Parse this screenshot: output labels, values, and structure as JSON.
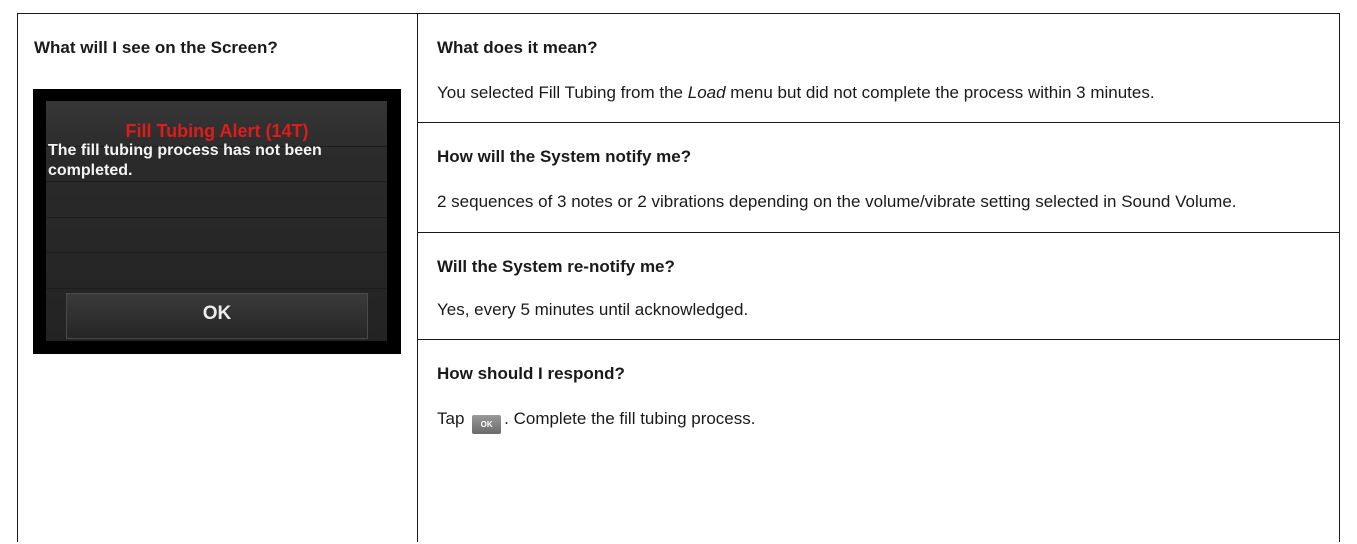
{
  "left": {
    "header": "What will I see on the Screen?",
    "screen": {
      "alert_title": "Fill Tubing Alert (14T)",
      "message": "The fill tubing process has not been completed.",
      "ok_label": "OK"
    }
  },
  "sections": [
    {
      "heading": "What does it mean?",
      "body_parts": [
        "You selected ",
        "Fill Tubing",
        " from the ",
        "Load",
        " menu but did not complete the process within 3 minutes."
      ]
    },
    {
      "heading": "How will the System notify me?",
      "body": "2 sequences of 3 notes or 2 vibrations depending on the volume/vibrate setting selected in Sound Volume."
    },
    {
      "heading": "Will the System re-notify me?",
      "body": "Yes, every 5 minutes until acknowledged."
    },
    {
      "heading": "How should I respond?",
      "body_prefix": "Tap ",
      "inline_button": "OK",
      "body_suffix": ". Complete the fill tubing process."
    }
  ]
}
